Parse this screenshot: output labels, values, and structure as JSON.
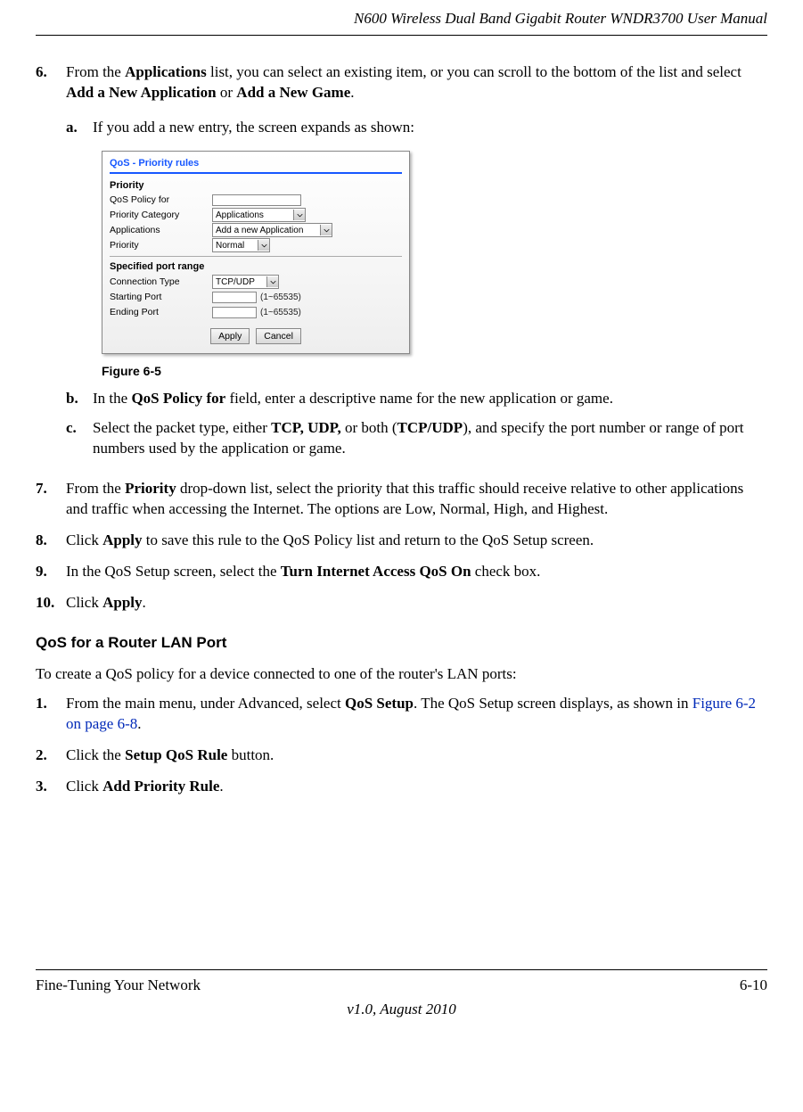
{
  "header": {
    "doc_title": "N600 Wireless Dual Band Gigabit Router WNDR3700 User Manual"
  },
  "step6": {
    "num": "6.",
    "text_1": "From the ",
    "b1": "Applications",
    "text_2": " list, you can select an existing item, or you can scroll to the bottom of the list and select ",
    "b2": "Add a New Application",
    "text_3": " or ",
    "b3": "Add a New Game",
    "text_4": ".",
    "a": {
      "letter": "a.",
      "text": "If you add a new entry, the screen expands as shown:"
    },
    "b": {
      "letter": "b.",
      "t1": "In the ",
      "b1": "QoS Policy for",
      "t2": " field, enter a descriptive name for the new application or game."
    },
    "c": {
      "letter": "c.",
      "t1": "Select the packet type, either ",
      "b1": "TCP, UDP,",
      "t2": " or both (",
      "b2": "TCP/UDP",
      "t3": "), and specify the port number or range of port numbers used by the application or game."
    }
  },
  "figure": {
    "caption": "Figure 6-5",
    "box_title": "QoS - Priority rules",
    "section_priority": "Priority",
    "lbl_policy_for": "QoS Policy for",
    "lbl_priority_cat": "Priority Category",
    "sel_priority_cat": "Applications",
    "lbl_applications": "Applications",
    "sel_applications": "Add a new Application",
    "lbl_priority": "Priority",
    "sel_priority": "Normal",
    "section_port": "Specified port range",
    "lbl_conn_type": "Connection Type",
    "sel_conn_type": "TCP/UDP",
    "lbl_start_port": "Starting Port",
    "hint_start": "(1~65535)",
    "lbl_end_port": "Ending Port",
    "hint_end": "(1~65535)",
    "btn_apply": "Apply",
    "btn_cancel": "Cancel"
  },
  "step7": {
    "num": "7.",
    "t1": "From the ",
    "b1": "Priority",
    "t2": " drop-down list, select the priority that this traffic should receive relative to other applications and traffic when accessing the Internet. The options are Low, Normal, High, and Highest."
  },
  "step8": {
    "num": "8.",
    "t1": "Click ",
    "b1": "Apply",
    "t2": " to save this rule to the QoS Policy list and return to the QoS Setup screen."
  },
  "step9": {
    "num": "9.",
    "t1": "In the QoS Setup screen, select the ",
    "b1": "Turn Internet Access QoS On",
    "t2": " check box."
  },
  "step10": {
    "num": "10.",
    "t1": "Click ",
    "b1": "Apply",
    "t2": "."
  },
  "section_lanport": {
    "heading": "QoS for a Router LAN Port",
    "intro": "To create a QoS policy for a device connected to one of the router's LAN ports:"
  },
  "lan1": {
    "num": "1.",
    "t1": "From the main menu, under Advanced, select ",
    "b1": "QoS Setup",
    "t2": ". The QoS Setup screen displays, as shown in ",
    "xref": "Figure 6-2 on page 6-8",
    "t3": "."
  },
  "lan2": {
    "num": "2.",
    "t1": "Click the ",
    "b1": "Setup QoS Rule",
    "t2": " button."
  },
  "lan3": {
    "num": "3.",
    "t1": "Click ",
    "b1": "Add Priority Rule",
    "t2": "."
  },
  "footer": {
    "left": "Fine-Tuning Your Network",
    "right": "6-10",
    "version": "v1.0, August 2010"
  }
}
